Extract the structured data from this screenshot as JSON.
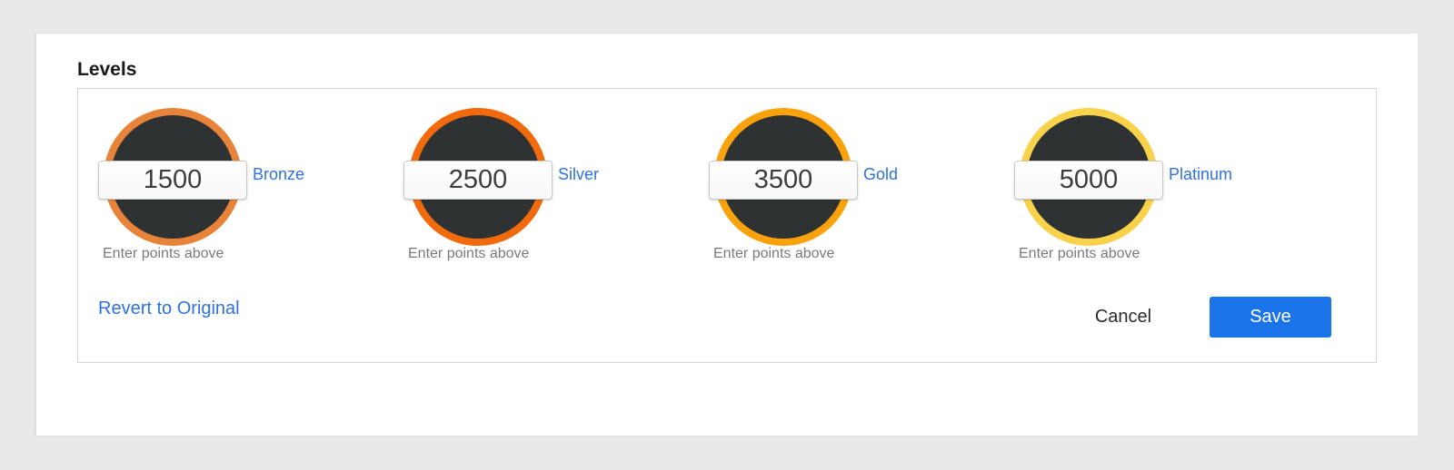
{
  "section": {
    "title": "Levels"
  },
  "levels": [
    {
      "name": "Bronze",
      "points": "1500",
      "hint": "Enter points above",
      "color": "#e8843a"
    },
    {
      "name": "Silver",
      "points": "2500",
      "hint": "Enter points above",
      "color": "#f26a0e"
    },
    {
      "name": "Gold",
      "points": "3500",
      "hint": "Enter points above",
      "color": "#f9a20c"
    },
    {
      "name": "Platinum",
      "points": "5000",
      "hint": "Enter points above",
      "color": "#f8d24b"
    }
  ],
  "actions": {
    "revert_label": "Revert to Original",
    "cancel_label": "Cancel",
    "save_label": "Save"
  },
  "colors": {
    "accent": "#1a73e8",
    "link": "#2f72dd",
    "badge_fill": "#2f3233"
  }
}
